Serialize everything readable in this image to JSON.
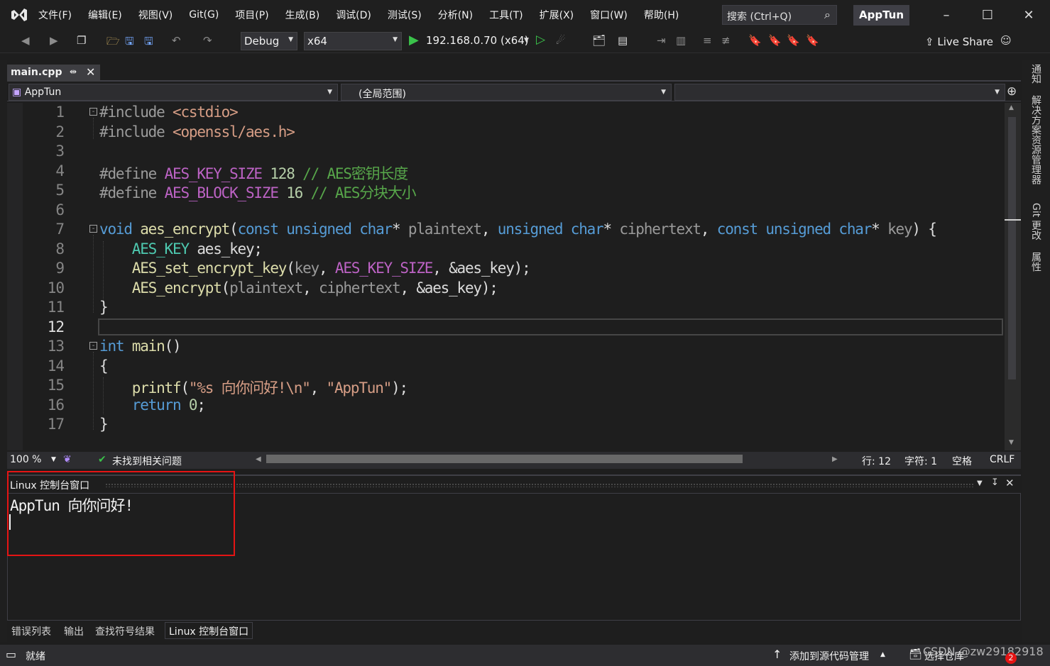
{
  "menubar": {
    "items": [
      "文件(F)",
      "编辑(E)",
      "视图(V)",
      "Git(G)",
      "项目(P)",
      "生成(B)",
      "调试(D)",
      "测试(S)",
      "分析(N)",
      "工具(T)",
      "扩展(X)",
      "窗口(W)",
      "帮助(H)"
    ],
    "search_placeholder": "搜索 (Ctrl+Q)",
    "app_title": "AppTun"
  },
  "toolbar": {
    "config": "Debug",
    "platform": "x64",
    "run_target": "192.168.0.70 (x64)",
    "live_share": "Live Share"
  },
  "tabs": {
    "active_file": "main.cpp"
  },
  "navbar": {
    "project": "AppTun",
    "scope": "(全局范围)"
  },
  "editor": {
    "line_numbers": [
      "1",
      "2",
      "3",
      "4",
      "5",
      "6",
      "7",
      "8",
      "9",
      "10",
      "11",
      "12",
      "13",
      "14",
      "15",
      "16",
      "17"
    ],
    "current_line": "12"
  },
  "editor_status": {
    "zoom": "100 %",
    "issues": "未找到相关问题",
    "line": "行: 12",
    "char": "字符: 1",
    "whitespace": "空格",
    "eol": "CRLF"
  },
  "console_panel": {
    "title": "Linux 控制台窗口",
    "output": "AppTun 向你问好!"
  },
  "bottom_tabs": [
    "错误列表",
    "输出",
    "查找符号结果",
    "Linux 控制台窗口"
  ],
  "statusbar": {
    "ready": "就绪",
    "source_control": "添加到源代码管理",
    "select_repo": "选择仓库",
    "watermark": "CSDN @zw29182918",
    "notif_count": "2"
  },
  "right_rail": [
    "通知",
    "解决方案资源管理器",
    "Git 更改",
    "属性"
  ]
}
